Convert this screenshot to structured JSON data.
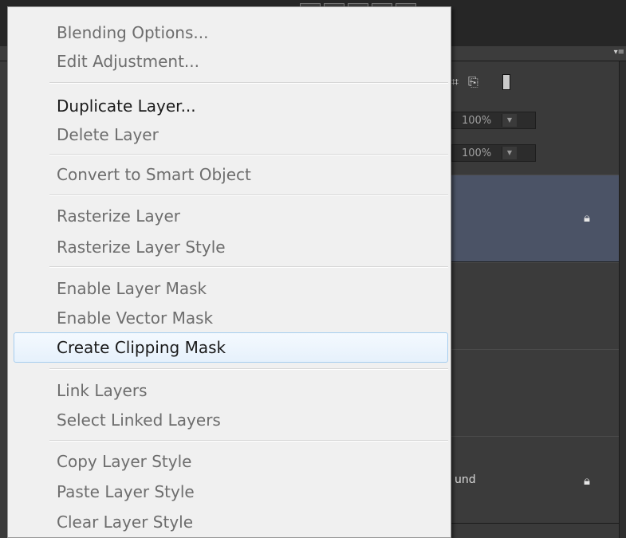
{
  "context_menu": {
    "items": [
      {
        "label": "Blending Options...",
        "enabled": false
      },
      {
        "label": "Edit Adjustment...",
        "enabled": false
      },
      {
        "label": "Duplicate Layer...",
        "enabled": true
      },
      {
        "label": "Delete Layer",
        "enabled": false
      },
      {
        "label": "Convert to Smart Object",
        "enabled": false
      },
      {
        "label": "Rasterize Layer",
        "enabled": false
      },
      {
        "label": "Rasterize Layer Style",
        "enabled": false
      },
      {
        "label": "Enable Layer Mask",
        "enabled": false
      },
      {
        "label": "Enable Vector Mask",
        "enabled": false
      },
      {
        "label": "Create Clipping Mask",
        "enabled": true,
        "hovered": true
      },
      {
        "label": "Link Layers",
        "enabled": false
      },
      {
        "label": "Select Linked Layers",
        "enabled": false
      },
      {
        "label": "Copy Layer Style",
        "enabled": false
      },
      {
        "label": "Paste Layer Style",
        "enabled": false
      },
      {
        "label": "Clear Layer Style",
        "enabled": false
      }
    ]
  },
  "layers_panel": {
    "opacity_value": "100%",
    "fill_value": "100%",
    "background_layer_name_partial": "und",
    "panel_menu_glyph": "▾≡"
  },
  "colors": {
    "menu_background": "#f0f0f0",
    "menu_hover_border": "#a6cdef",
    "selected_layer": "#4b5366",
    "panel_background": "#3a3a3a"
  }
}
